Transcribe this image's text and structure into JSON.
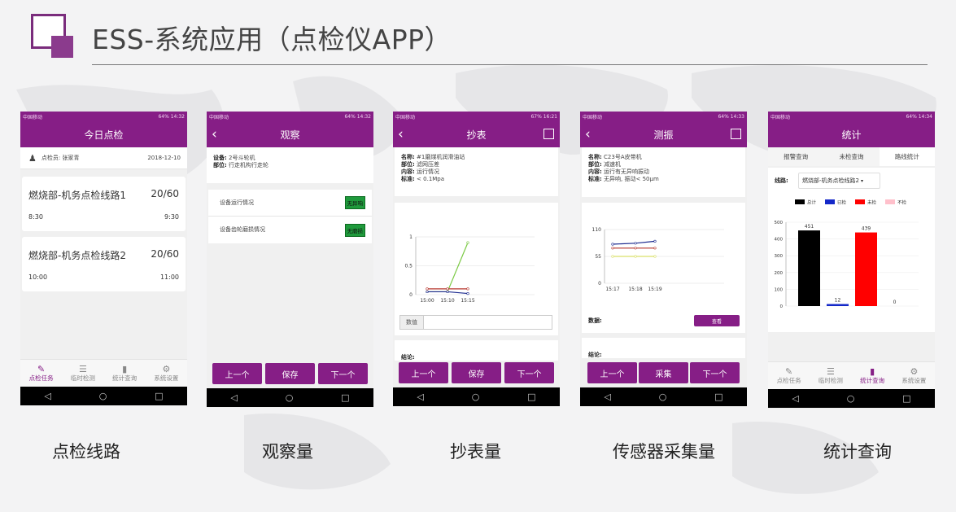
{
  "slide": {
    "title": "ESS-系统应用（点检仪APP）"
  },
  "colors": {
    "brand": "#861e86",
    "logo_dark": "#7a2c7c",
    "logo_light": "#8b3b8d"
  },
  "status_bar": {
    "s1": {
      "carrier": "中国移动",
      "right": "64% 14:32"
    },
    "s2": {
      "carrier": "中国移动",
      "right": "64% 14:32"
    },
    "s3": {
      "carrier": "中国移动",
      "right": "67% 16:21"
    },
    "s4": {
      "carrier": "中国移动",
      "right": "64% 14:33"
    },
    "s5": {
      "carrier": "中国移动",
      "right": "64% 14:34"
    }
  },
  "nav": {
    "back": "◁",
    "home": "○",
    "recent": "□"
  },
  "tabs": [
    {
      "label": "点检任务",
      "icon": "edit-icon"
    },
    {
      "label": "临时检测",
      "icon": "tree-icon"
    },
    {
      "label": "统计查询",
      "icon": "bar-chart-icon"
    },
    {
      "label": "系统设置",
      "icon": "gear-icon"
    }
  ],
  "screen1": {
    "title": "今日点检",
    "inspector": "点检员: 张家青",
    "date": "2018-12-10",
    "routes": [
      {
        "name": "燃烧部-机务点检线路1",
        "count": "20/60",
        "start": "8:30",
        "end": "9:30"
      },
      {
        "name": "燃烧部-机务点检线路2",
        "count": "20/60",
        "start": "10:00",
        "end": "11:00"
      }
    ]
  },
  "screen2": {
    "title": "观察",
    "device_label": "设备:",
    "device": "2号斗轮机",
    "part_label": "部位:",
    "part": "行走机构行走轮",
    "items": [
      {
        "label": "设备运行情况",
        "status": "无异响"
      },
      {
        "label": "设备齿轮磨损情况",
        "status": "无磨损"
      }
    ]
  },
  "screen3": {
    "title": "抄表",
    "fields": [
      {
        "label": "名称:",
        "value": "#1磨煤机润滑油站"
      },
      {
        "label": "部位:",
        "value": "滤网压差"
      },
      {
        "label": "内容:",
        "value": "运行情况"
      },
      {
        "label": "标准:",
        "value": "< 0.1Mpa"
      }
    ],
    "input_label": "数值",
    "conclusion_label": "结论:"
  },
  "screen4": {
    "title": "测振",
    "fields": [
      {
        "label": "名称:",
        "value": "C23号A皮带机"
      },
      {
        "label": "部位:",
        "value": "减速机"
      },
      {
        "label": "内容:",
        "value": "运行有无异响振动"
      },
      {
        "label": "标准:",
        "value": "无异响, 振动< 50μm"
      }
    ],
    "data_label": "数据:",
    "view_button": "查看",
    "conclusion_label": "结论:"
  },
  "screen5": {
    "title": "统计",
    "top_tabs": [
      "报警查询",
      "未检查询",
      "路线统计"
    ],
    "route_label": "线路:",
    "route_value": "燃烧部-机务点检线路2"
  },
  "buttons": {
    "prev": "上一个",
    "save": "保存",
    "next": "下一个",
    "collect": "采集"
  },
  "captions": [
    "点检线路",
    "观察量",
    "抄表量",
    "传感器采集量",
    "统计查询"
  ],
  "chart_data": [
    {
      "type": "line",
      "x": [
        "15:00",
        "15:10",
        "15:15"
      ],
      "yticks": [
        "0",
        "0.5",
        "1"
      ],
      "ylim": [
        0,
        1
      ],
      "series": [
        {
          "color": "#7ac943",
          "values": [
            0.05,
            0.05,
            0.9
          ]
        },
        {
          "color": "#1d2b8f",
          "values": [
            0.05,
            0.05,
            0.02
          ]
        },
        {
          "color": "#b5332a",
          "values": [
            0.1,
            0.1,
            0.1
          ]
        }
      ]
    },
    {
      "type": "line",
      "x": [
        "15:17",
        "15:18",
        "15:19"
      ],
      "yticks": [
        "0",
        "55",
        "110"
      ],
      "ylim": [
        0,
        110
      ],
      "series": [
        {
          "color": "#1d2b8f",
          "values": [
            80,
            82,
            86
          ]
        },
        {
          "color": "#b5332a",
          "values": [
            72,
            72,
            72
          ]
        },
        {
          "color": "#d9e06a",
          "values": [
            55,
            55,
            55
          ]
        }
      ]
    },
    {
      "type": "bar",
      "categories": [
        "总计",
        "已检",
        "未检",
        "不检"
      ],
      "values": [
        451,
        12,
        439,
        0
      ],
      "colors": [
        "#000000",
        "#1428c8",
        "#ff0000",
        "#ffc0cb"
      ],
      "yticks": [
        "0",
        "100",
        "200",
        "300",
        "400",
        "500"
      ],
      "ylim": [
        0,
        500
      ]
    }
  ]
}
